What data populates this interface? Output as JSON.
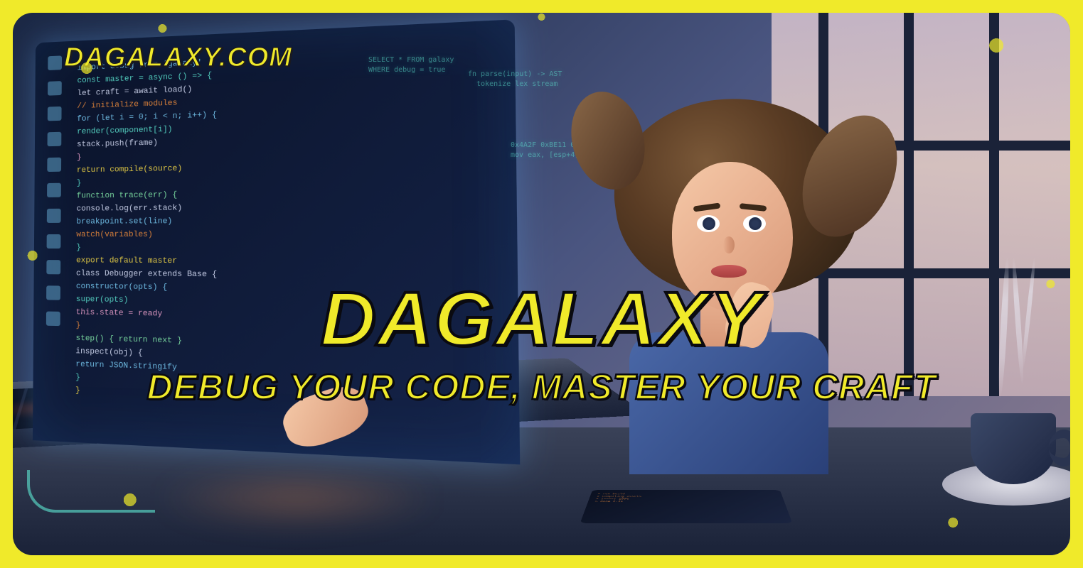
{
  "site_url": "DAGALAXY.COM",
  "brand_title": "DAGALAXY",
  "tagline": "DEBUG YOUR CODE, MASTER YOUR CRAFT"
}
